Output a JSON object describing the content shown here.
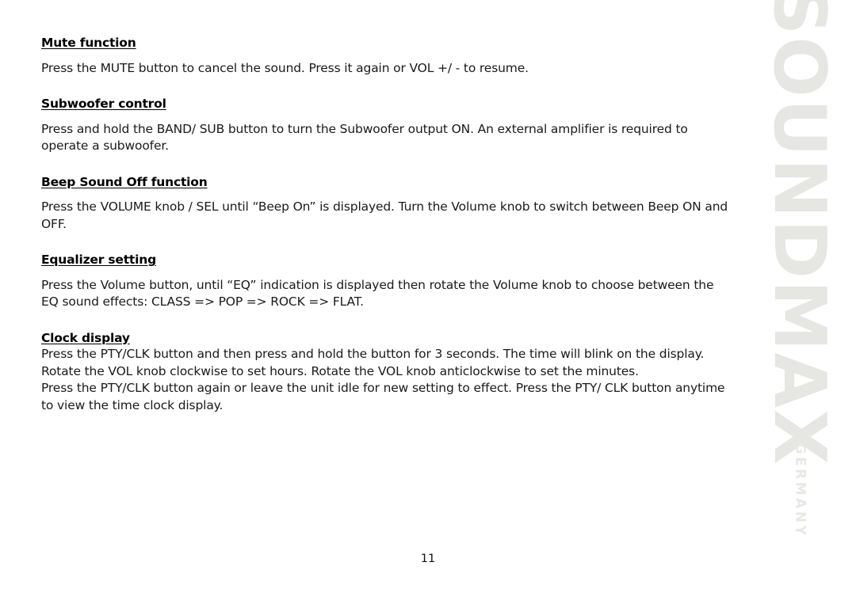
{
  "document": {
    "page_number": "11",
    "watermark": {
      "brand": "SOUNDMAX",
      "tagline": "GERMANY",
      "color": "#e6e6e2"
    }
  },
  "sections": [
    {
      "heading": "Mute function",
      "paragraphs": [
        "Press the MUTE button to cancel the sound. Press it again or VOL +/ - to resume."
      ]
    },
    {
      "heading": "Subwoofer control",
      "paragraphs": [
        "Press and hold the BAND/ SUB button to turn the Subwoofer output ON. An external amplifier is required to operate a subwoofer."
      ]
    },
    {
      "heading": "Beep Sound Off function",
      "paragraphs": [
        "Press the VOLUME knob / SEL until “Beep On” is displayed. Turn the Volume knob to switch between Beep ON and OFF."
      ]
    },
    {
      "heading": "Equalizer setting",
      "paragraphs": [
        "Press the Volume button, until “EQ” indication is displayed then rotate the Volume knob to choose between the EQ sound effects: CLASS => POP => ROCK => FLAT."
      ]
    },
    {
      "heading": "Clock display",
      "paragraphs": [
        "Press the PTY/CLK button and then press and hold the button for 3 seconds. The time will blink on the display.",
        "Rotate the VOL knob clockwise to set hours. Rotate the VOL knob anticlockwise to set the minutes.",
        "Press the PTY/CLK button again or leave the unit idle for new setting to effect. Press the PTY/ CLK button anytime to view the time clock display."
      ]
    }
  ]
}
